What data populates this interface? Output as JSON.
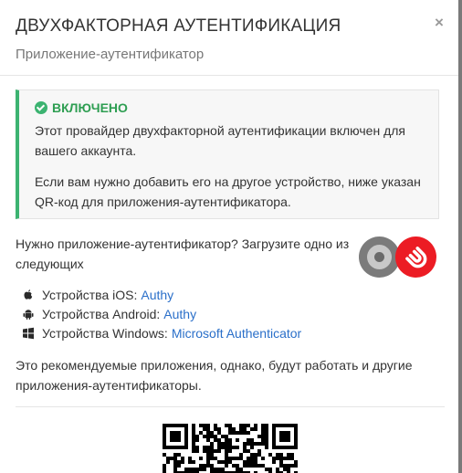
{
  "modal": {
    "title": "ДВУХФАКТОРНАЯ АУТЕНТИФИКАЦИЯ",
    "subtitle": "Приложение-аутентификатор",
    "close_label": "×"
  },
  "status": {
    "label": "ВКЛЮЧЕНО",
    "color": "#3cb371",
    "text1": "Этот провайдер двухфакторной аутентификации включен для вашего аккаунта.",
    "text2": "Если вам нужно добавить его на другое устройство, ниже указан QR-код для приложения-аутентификатора."
  },
  "download": {
    "intro": "Нужно приложение-аутентификатор? Загрузите одно из следующих",
    "logos": [
      "google-authenticator-icon",
      "authy-icon"
    ],
    "apps": [
      {
        "device": "Устройства iOS:",
        "app": "Authy",
        "icon": "apple-icon"
      },
      {
        "device": "Устройства Android:",
        "app": "Authy",
        "icon": "android-icon"
      },
      {
        "device": "Устройства Windows:",
        "app": "Microsoft Authenticator",
        "icon": "windows-icon"
      }
    ],
    "note": "Это рекомендуемые приложения, однако, будут работать и другие приложения-аутентификаторы."
  },
  "qr": {
    "icon": "qr-code"
  },
  "colors": {
    "link": "#2a6fc9",
    "success": "#3cb371",
    "authy": "#ec1c24"
  }
}
